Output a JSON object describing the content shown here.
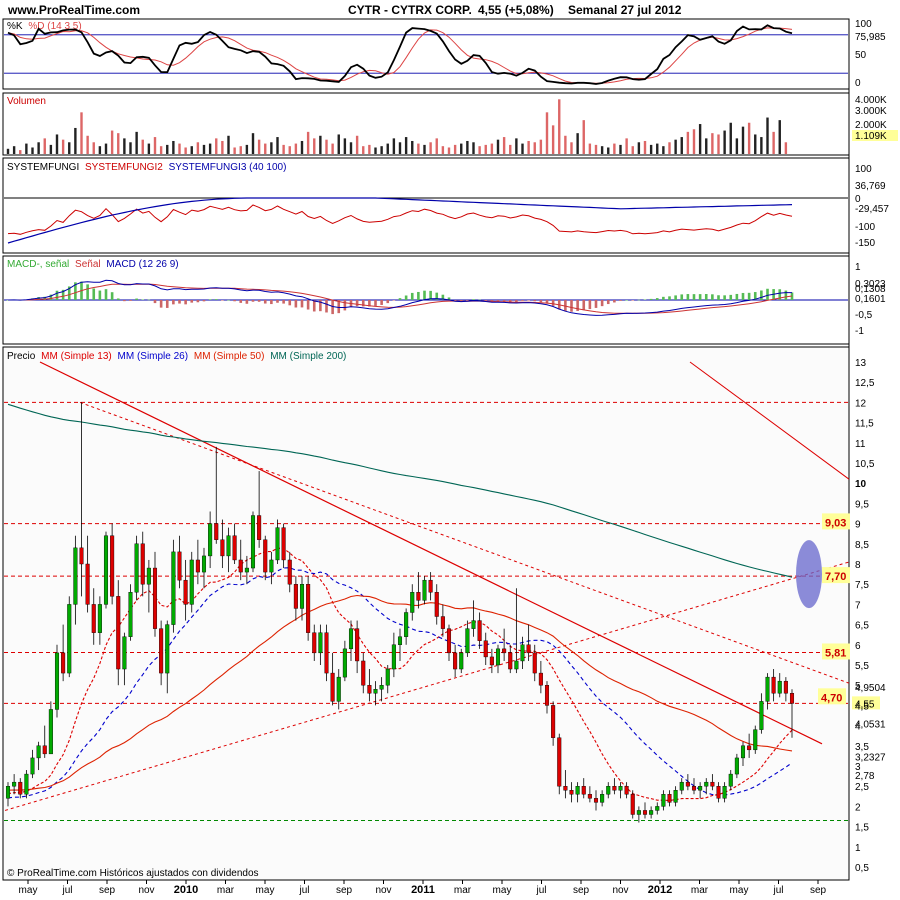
{
  "header": {
    "site": "www.ProRealTime.com",
    "title": "CYTR - CYTRX CORP.",
    "change": "4,55 (+5,08%)",
    "period": "Semanal  27 jul 2012"
  },
  "footer": "© ProRealTime.com  Históricos ajustados con dividendos",
  "colors": {
    "bull": "#00aa00",
    "bear": "#dd0000",
    "sma13": "#dd0000",
    "sma26": "#0000cc",
    "sma50": "#dd2200",
    "sma200": "#006655",
    "stoch_k": "#000000",
    "stoch_d": "#dd4444",
    "macd_pos": "#55bb55",
    "macd_neg": "#cc6666",
    "fungi1": "#000000",
    "fungi2": "#cc0000",
    "fungi3": "#0000aa",
    "label_bg": "#ffff99",
    "cloud": "#6666cc"
  },
  "panels": {
    "stoch": {
      "title_k": "%K",
      "title_d": "%D (14 3 5)",
      "axis": [
        "100",
        "50",
        "0"
      ],
      "value_label": "75,985"
    },
    "volume": {
      "title": "Volumen",
      "axis": [
        "4.000K",
        "3.000K",
        "2.000K"
      ],
      "value_label": "1.109K"
    },
    "fungi": {
      "title_1": "SYSTEMFUNGI",
      "title_2": "SYSTEMFUNGI2",
      "title_3": "SYSTEMFUNGI3 (40 100)",
      "axis": [
        "100",
        "0",
        "-100",
        "-150"
      ],
      "value_1": "36,769",
      "value_2": "0",
      "value_3": "-29,457"
    },
    "macd": {
      "title_1": "MACD-, señal",
      "title_2": "Señal",
      "title_3": "MACD (12 26 9)",
      "axis": [
        "1",
        "0,5",
        "-0,5",
        "-1"
      ],
      "value_1": "0,3023",
      "value_2": "0,1308",
      "value_3": "0,1601"
    },
    "price": {
      "title_1": "Precio",
      "title_2": "MM (Simple 13)",
      "title_3": "MM (Simple 26)",
      "title_4": "MM (Simple 50)",
      "title_5": "MM (Simple 200)",
      "axis": [
        "13",
        "12,5",
        "12",
        "11,5",
        "11",
        "10,5",
        "10",
        "9,5",
        "9",
        "8,5",
        "8",
        "7,5",
        "7",
        "6,5",
        "6",
        "5,5",
        "5",
        "4,5",
        "4",
        "3,5",
        "3",
        "2,5",
        "2",
        "1,5",
        "1",
        "0,5"
      ],
      "level_labels": [
        "9,03",
        "7,70",
        "5,81",
        "4,70"
      ],
      "value_labels": [
        "4,9504",
        "4,55",
        "4,0531",
        "3,2327",
        "2,78"
      ]
    }
  },
  "x_axis": [
    "may",
    "jul",
    "sep",
    "nov",
    "2010",
    "mar",
    "may",
    "jul",
    "sep",
    "nov",
    "2011",
    "mar",
    "may",
    "jul",
    "sep",
    "nov",
    "2012",
    "mar",
    "may",
    "jul",
    "sep"
  ],
  "chart_data": {
    "type": "candlestick",
    "title": "CYTR - CYTRX CORP.",
    "x_labels": [
      "may",
      "jul",
      "sep",
      "nov",
      "2010",
      "mar",
      "may",
      "jul",
      "sep",
      "nov",
      "2011",
      "mar",
      "may",
      "jul",
      "sep",
      "nov",
      "2012",
      "mar",
      "may",
      "jul",
      "sep"
    ],
    "ylim": [
      0.3,
      13.3
    ],
    "horizontal_levels": [
      12,
      9,
      7.7,
      5.81,
      4.7,
      4.55,
      1.65
    ],
    "ohlc_weekly": [
      [
        2.2,
        2.6,
        2.0,
        2.5
      ],
      [
        2.5,
        2.8,
        2.3,
        2.6
      ],
      [
        2.6,
        2.7,
        2.2,
        2.3
      ],
      [
        2.3,
        2.9,
        2.2,
        2.8
      ],
      [
        2.8,
        3.4,
        2.7,
        3.2
      ],
      [
        3.2,
        3.6,
        2.9,
        3.5
      ],
      [
        3.5,
        4.0,
        3.2,
        3.3
      ],
      [
        3.3,
        4.6,
        3.3,
        4.4
      ],
      [
        4.4,
        6.0,
        4.2,
        5.8
      ],
      [
        5.8,
        6.5,
        5.1,
        5.3
      ],
      [
        5.3,
        7.2,
        5.2,
        7.0
      ],
      [
        7.0,
        8.7,
        6.5,
        8.4
      ],
      [
        8.4,
        12.0,
        7.2,
        8.0
      ],
      [
        8.0,
        8.7,
        6.8,
        7.0
      ],
      [
        7.0,
        7.4,
        6.0,
        6.3
      ],
      [
        6.3,
        7.2,
        6.0,
        7.0
      ],
      [
        7.0,
        8.8,
        6.9,
        8.7
      ],
      [
        8.7,
        9.0,
        7.0,
        7.2
      ],
      [
        7.2,
        7.6,
        5.0,
        5.4
      ],
      [
        5.4,
        6.3,
        5.0,
        6.2
      ],
      [
        6.2,
        7.5,
        6.1,
        7.3
      ],
      [
        7.3,
        8.7,
        7.1,
        8.5
      ],
      [
        8.5,
        8.8,
        7.2,
        7.5
      ],
      [
        7.5,
        8.1,
        6.8,
        7.9
      ],
      [
        7.9,
        8.3,
        6.2,
        6.4
      ],
      [
        6.4,
        6.6,
        5.0,
        5.3
      ],
      [
        5.3,
        6.6,
        4.8,
        6.5
      ],
      [
        6.5,
        8.6,
        6.3,
        8.3
      ],
      [
        8.3,
        8.7,
        7.4,
        7.6
      ],
      [
        7.6,
        8.1,
        6.6,
        7.0
      ],
      [
        7.0,
        8.3,
        6.8,
        8.1
      ],
      [
        8.1,
        8.6,
        7.5,
        7.8
      ],
      [
        7.8,
        8.4,
        7.4,
        8.2
      ],
      [
        8.2,
        9.3,
        7.9,
        9.0
      ],
      [
        9.0,
        10.9,
        8.5,
        8.6
      ],
      [
        8.6,
        9.1,
        7.9,
        8.2
      ],
      [
        8.2,
        8.9,
        7.8,
        8.7
      ],
      [
        8.7,
        9.0,
        8.0,
        8.1
      ],
      [
        8.1,
        8.6,
        7.6,
        7.8
      ],
      [
        7.8,
        8.2,
        7.5,
        7.9
      ],
      [
        7.9,
        9.3,
        7.8,
        9.2
      ],
      [
        9.2,
        10.3,
        8.4,
        8.6
      ],
      [
        8.6,
        8.7,
        7.6,
        7.8
      ],
      [
        7.8,
        8.3,
        7.5,
        8.1
      ],
      [
        8.1,
        9.1,
        8.0,
        8.9
      ],
      [
        8.9,
        9.0,
        7.9,
        8.1
      ],
      [
        8.1,
        8.3,
        7.3,
        7.5
      ],
      [
        7.5,
        7.7,
        6.6,
        6.9
      ],
      [
        6.9,
        7.7,
        6.6,
        7.5
      ],
      [
        7.5,
        7.7,
        6.1,
        6.3
      ],
      [
        6.3,
        6.5,
        5.6,
        5.8
      ],
      [
        5.8,
        6.5,
        5.5,
        6.3
      ],
      [
        6.3,
        6.5,
        5.1,
        5.3
      ],
      [
        5.3,
        5.8,
        4.5,
        4.6
      ],
      [
        4.6,
        5.4,
        4.4,
        5.2
      ],
      [
        5.2,
        6.1,
        5.1,
        5.9
      ],
      [
        5.9,
        6.6,
        5.6,
        6.4
      ],
      [
        6.4,
        6.6,
        5.3,
        5.6
      ],
      [
        5.6,
        5.8,
        4.8,
        5.0
      ],
      [
        5.0,
        5.4,
        4.6,
        4.8
      ],
      [
        4.8,
        5.1,
        4.5,
        4.9
      ],
      [
        4.9,
        5.2,
        4.6,
        5.0
      ],
      [
        5.0,
        5.5,
        4.8,
        5.4
      ],
      [
        5.4,
        6.3,
        5.2,
        6.0
      ],
      [
        6.0,
        6.4,
        5.6,
        6.2
      ],
      [
        6.2,
        6.9,
        6.0,
        6.8
      ],
      [
        6.8,
        7.5,
        6.6,
        7.3
      ],
      [
        7.3,
        7.8,
        6.9,
        7.1
      ],
      [
        7.1,
        7.7,
        7.0,
        7.6
      ],
      [
        7.6,
        7.8,
        7.1,
        7.3
      ],
      [
        7.3,
        7.5,
        6.5,
        6.7
      ],
      [
        6.7,
        7.0,
        6.2,
        6.4
      ],
      [
        6.4,
        6.5,
        5.6,
        5.8
      ],
      [
        5.8,
        6.0,
        5.2,
        5.4
      ],
      [
        5.4,
        5.9,
        5.3,
        5.8
      ],
      [
        5.8,
        6.6,
        5.7,
        6.4
      ],
      [
        6.4,
        7.1,
        6.2,
        6.6
      ],
      [
        6.6,
        6.8,
        5.9,
        6.1
      ],
      [
        6.1,
        6.3,
        5.5,
        5.7
      ],
      [
        5.7,
        5.9,
        5.3,
        5.5
      ],
      [
        5.5,
        6.0,
        5.3,
        5.9
      ],
      [
        5.9,
        6.4,
        5.6,
        5.8
      ],
      [
        5.8,
        6.0,
        5.3,
        5.4
      ],
      [
        5.4,
        7.4,
        5.3,
        5.6
      ],
      [
        5.6,
        6.2,
        5.4,
        6.0
      ],
      [
        6.0,
        6.5,
        5.6,
        5.8
      ],
      [
        5.8,
        6.0,
        5.1,
        5.3
      ],
      [
        5.3,
        5.6,
        4.8,
        5.0
      ],
      [
        5.0,
        5.1,
        4.3,
        4.5
      ],
      [
        4.5,
        4.6,
        3.5,
        3.7
      ],
      [
        3.7,
        3.8,
        2.3,
        2.5
      ],
      [
        2.5,
        2.9,
        2.2,
        2.4
      ],
      [
        2.4,
        2.6,
        2.1,
        2.3
      ],
      [
        2.3,
        2.6,
        2.1,
        2.5
      ],
      [
        2.5,
        2.7,
        2.2,
        2.3
      ],
      [
        2.3,
        2.5,
        2.1,
        2.2
      ],
      [
        2.2,
        2.4,
        1.9,
        2.1
      ],
      [
        2.1,
        2.4,
        2.0,
        2.3
      ],
      [
        2.3,
        2.6,
        2.2,
        2.5
      ],
      [
        2.5,
        2.7,
        2.3,
        2.4
      ],
      [
        2.4,
        2.6,
        2.2,
        2.5
      ],
      [
        2.5,
        2.6,
        2.2,
        2.3
      ],
      [
        2.3,
        2.4,
        1.7,
        1.8
      ],
      [
        1.8,
        2.0,
        1.6,
        1.9
      ],
      [
        1.9,
        2.1,
        1.7,
        1.8
      ],
      [
        1.8,
        2.0,
        1.7,
        1.9
      ],
      [
        1.9,
        2.1,
        1.8,
        2.0
      ],
      [
        2.0,
        2.4,
        1.9,
        2.3
      ],
      [
        2.3,
        2.4,
        2.0,
        2.1
      ],
      [
        2.1,
        2.5,
        2.0,
        2.4
      ],
      [
        2.4,
        2.7,
        2.3,
        2.6
      ],
      [
        2.6,
        2.8,
        2.4,
        2.5
      ],
      [
        2.5,
        2.7,
        2.3,
        2.4
      ],
      [
        2.4,
        2.6,
        2.2,
        2.5
      ],
      [
        2.5,
        2.7,
        2.3,
        2.6
      ],
      [
        2.6,
        2.8,
        2.4,
        2.5
      ],
      [
        2.5,
        2.6,
        2.1,
        2.2
      ],
      [
        2.2,
        2.6,
        2.1,
        2.5
      ],
      [
        2.5,
        2.9,
        2.4,
        2.8
      ],
      [
        2.8,
        3.3,
        2.7,
        3.2
      ],
      [
        3.2,
        3.6,
        3.0,
        3.5
      ],
      [
        3.5,
        3.8,
        3.2,
        3.4
      ],
      [
        3.4,
        4.0,
        3.3,
        3.9
      ],
      [
        3.9,
        4.8,
        3.8,
        4.6
      ],
      [
        4.6,
        5.3,
        4.4,
        5.2
      ],
      [
        5.2,
        5.4,
        4.6,
        4.8
      ],
      [
        4.8,
        5.3,
        4.7,
        5.1
      ],
      [
        5.1,
        5.2,
        4.6,
        4.8
      ],
      [
        4.8,
        4.9,
        3.7,
        4.55
      ]
    ],
    "volume_k": [
      400,
      600,
      300,
      800,
      500,
      900,
      1200,
      700,
      1500,
      1100,
      900,
      2000,
      3200,
      1400,
      900,
      600,
      800,
      1800,
      1600,
      1200,
      900,
      1700,
      1100,
      800,
      1300,
      600,
      700,
      1000,
      800,
      500,
      600,
      900,
      700,
      800,
      1200,
      1000,
      1400,
      500,
      600,
      700,
      1600,
      1100,
      800,
      900,
      1300,
      700,
      600,
      800,
      1000,
      1700,
      1200,
      1400,
      1100,
      800,
      1500,
      1200,
      900,
      1400,
      600,
      700,
      500,
      600,
      800,
      1200,
      900,
      1300,
      1000,
      800,
      700,
      900,
      1200,
      600,
      500,
      700,
      800,
      1000,
      900,
      600,
      700,
      800,
      1100,
      1300,
      700,
      1200,
      800,
      1000,
      900,
      1100,
      3200,
      2200,
      4200,
      1400,
      900,
      1600,
      2600,
      800,
      700,
      600,
      500,
      800,
      700,
      1200,
      600,
      900,
      1000,
      700,
      800,
      600,
      900,
      1100,
      1300,
      1700,
      1900,
      2300,
      1200,
      1600,
      1500,
      1800,
      2400,
      1200,
      2100,
      2400,
      1500,
      1300,
      2800,
      1700,
      2600,
      900
    ],
    "stochastic_last": 75.985,
    "volume_last_k": 1109,
    "macd_last": [
      0.3023,
      0.1308,
      0.1601
    ],
    "fungi_last": [
      36.769,
      0,
      -29.457
    ],
    "sma_last": {
      "sma13": 4.0531,
      "sma26": 3.2327,
      "sma50": 2.78,
      "sma200": 4.9504
    }
  }
}
